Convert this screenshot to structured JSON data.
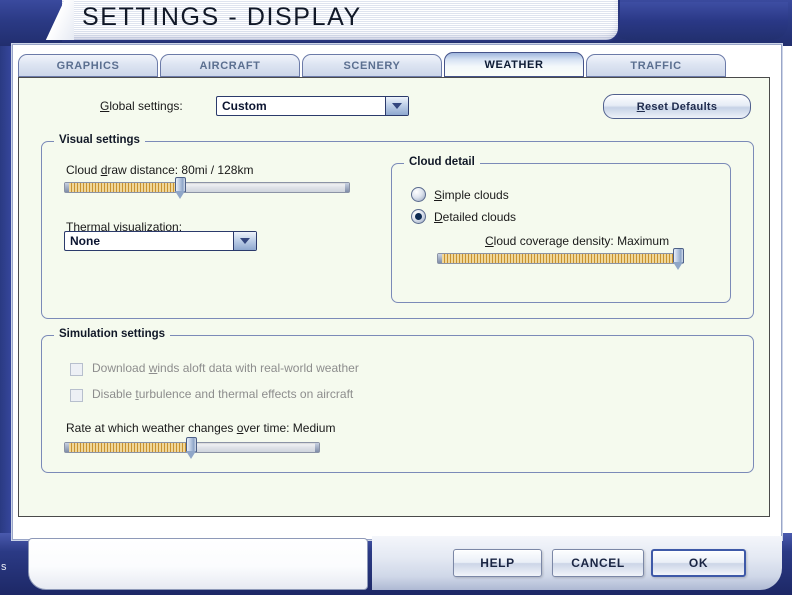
{
  "window": {
    "title": "SETTINGS - DISPLAY",
    "edge_label": "s"
  },
  "tabs": [
    {
      "label": "GRAPHICS",
      "active": false
    },
    {
      "label": "AIRCRAFT",
      "active": false
    },
    {
      "label": "SCENERY",
      "active": false
    },
    {
      "label": "WEATHER",
      "active": true
    },
    {
      "label": "TRAFFIC",
      "active": false
    }
  ],
  "toolbar": {
    "global_settings_label": "Global settings:",
    "global_settings_value": "Custom",
    "reset_defaults_label": "Reset Defaults"
  },
  "visual_settings": {
    "legend": "Visual settings",
    "cloud_draw_distance_label": "Cloud draw distance: 80mi / 128km",
    "cloud_draw_distance_value": "80mi / 128km",
    "cloud_draw_distance_percent": 41,
    "thermal_visualization_label": "Thermal visualization:",
    "thermal_visualization_value": "None",
    "cloud_detail": {
      "legend": "Cloud detail",
      "options": [
        {
          "label": "Simple clouds",
          "selected": false
        },
        {
          "label": "Detailed clouds",
          "selected": true
        }
      ],
      "coverage_density_label": "Cloud coverage density: Maximum",
      "coverage_density_value": "Maximum",
      "coverage_density_percent": 100
    }
  },
  "simulation_settings": {
    "legend": "Simulation settings",
    "checkboxes": [
      {
        "label": "Download winds aloft data with real-world weather",
        "checked": false,
        "disabled": true
      },
      {
        "label": "Disable turbulence and thermal effects on aircraft",
        "checked": false,
        "disabled": true
      }
    ],
    "rate_label": "Rate at which weather changes over time: Medium",
    "rate_value": "Medium",
    "rate_percent": 50
  },
  "footer": {
    "help_label": "HELP",
    "cancel_label": "CANCEL",
    "ok_label": "OK"
  },
  "colors": {
    "chrome_blue": "#2b3a85",
    "panel_bg": "#f5faee",
    "slider_fill": "#c8922f",
    "active_tab_text": "#0d1b34",
    "inactive_tab_text": "#5b6f90"
  }
}
